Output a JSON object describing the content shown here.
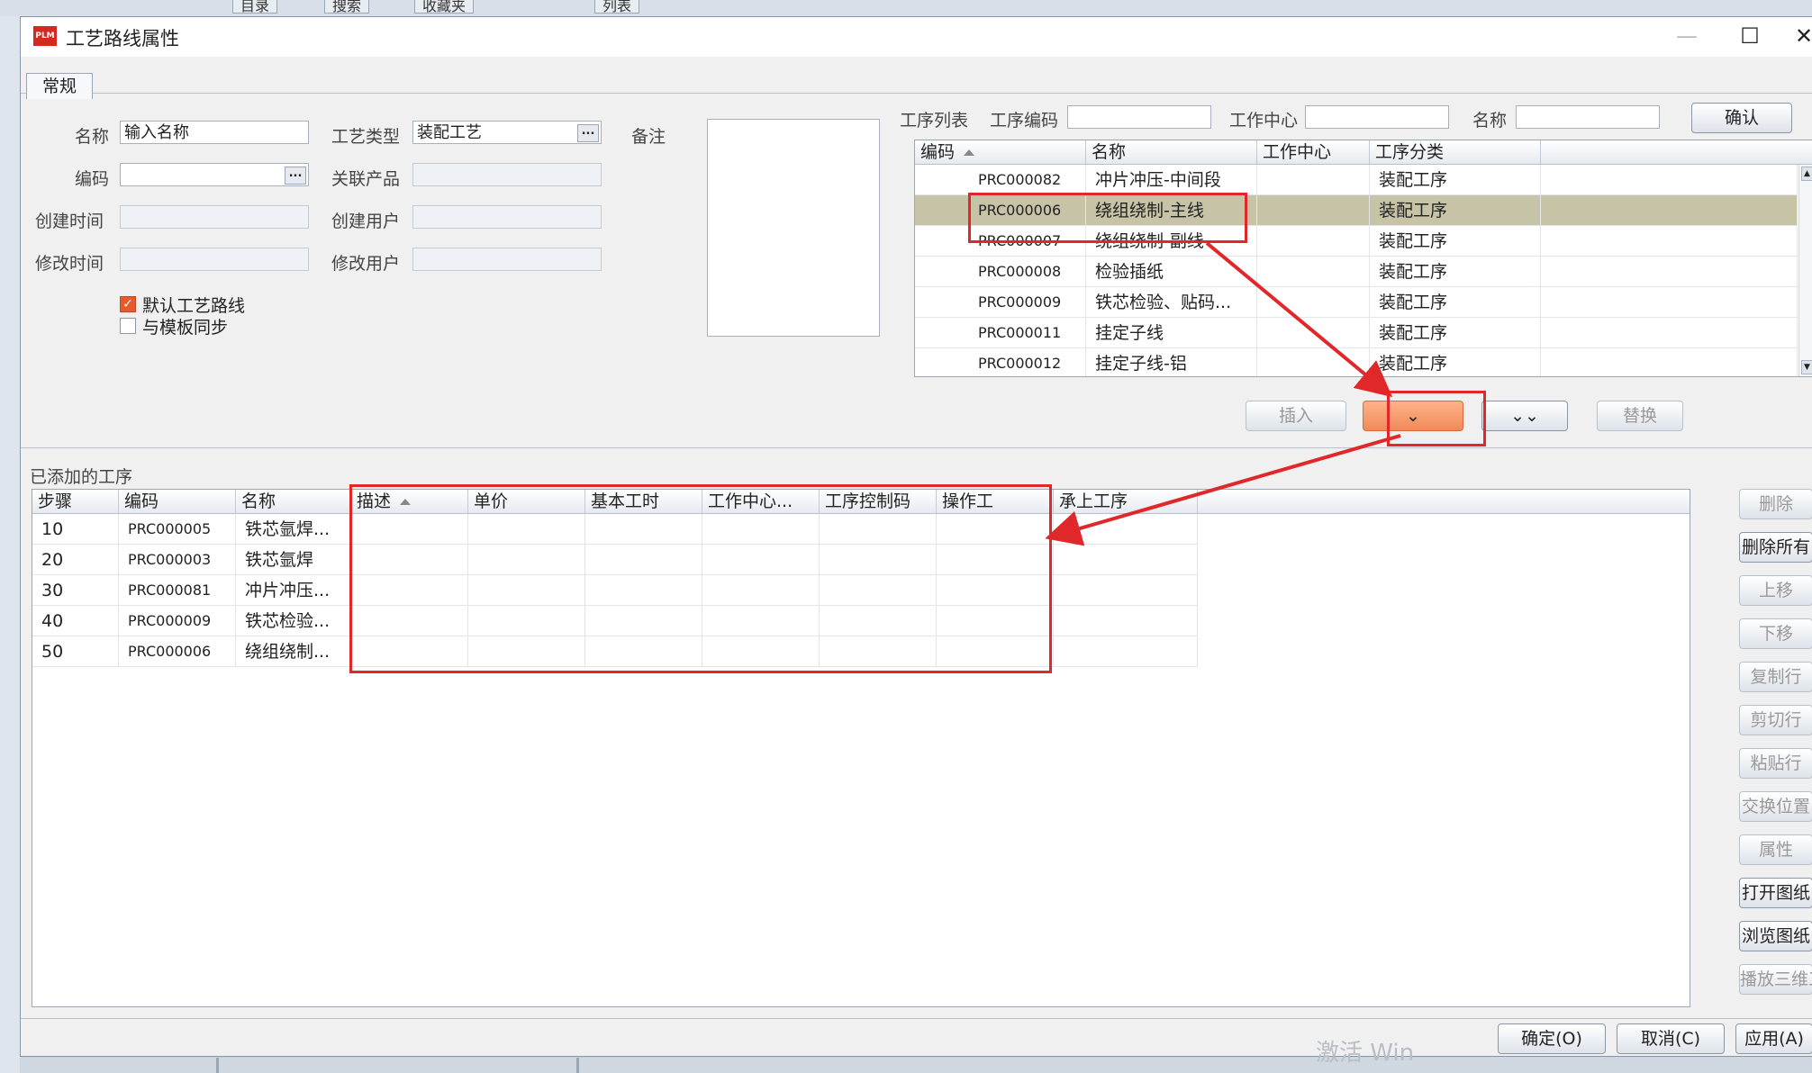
{
  "background": {
    "tabs": [
      "目录",
      "搜索",
      "收藏夹",
      "列表"
    ]
  },
  "window": {
    "title": "工艺路线属性",
    "app_icon": "PLM",
    "controls": {
      "minimize": "—",
      "maximize": "☐",
      "close": "✕"
    }
  },
  "tabs": {
    "general": "常规"
  },
  "form": {
    "name_label": "名称",
    "name_value": "输入名称",
    "code_label": "编码",
    "code_value": "",
    "created_time_label": "创建时间",
    "created_time_value": "",
    "modified_time_label": "修改时间",
    "modified_time_value": "",
    "process_type_label": "工艺类型",
    "process_type_value": "装配工艺",
    "related_product_label": "关联产品",
    "related_product_value": "",
    "created_user_label": "创建用户",
    "created_user_value": "",
    "modified_user_label": "修改用户",
    "modified_user_value": "",
    "remark_label": "备注",
    "default_route_label": "默认工艺路线",
    "default_route_checked": true,
    "template_sync_label": "与模板同步",
    "template_sync_checked": false,
    "ellipsis": "..."
  },
  "filter": {
    "op_list_label": "工序列表",
    "op_code_label": "工序编码",
    "work_center_label": "工作中心",
    "name_label": "名称",
    "confirm_button": "确认"
  },
  "op_grid": {
    "columns": [
      "编码",
      "名称",
      "工作中心",
      "工序分类"
    ],
    "rows": [
      [
        "PRC000082",
        "冲片冲压-中间段",
        "",
        "装配工序"
      ],
      [
        "PRC000006",
        "绕组绕制-主线",
        "",
        "装配工序"
      ],
      [
        "PRC000007",
        "绕组绕制-副线",
        "",
        "装配工序"
      ],
      [
        "PRC000008",
        "检验插纸",
        "",
        "装配工序"
      ],
      [
        "PRC000009",
        "铁芯检验、贴码...",
        "",
        "装配工序"
      ],
      [
        "PRC000011",
        "挂定子线",
        "",
        "装配工序"
      ],
      [
        "PRC000012",
        "挂定子线-铝",
        "",
        "装配工序"
      ]
    ],
    "selected_row": 1
  },
  "middle_buttons": {
    "insert": "插入",
    "add_down": "⌄",
    "add_all_down": "⌄⌄",
    "replace": "替换"
  },
  "added": {
    "section_label": "已添加的工序",
    "columns": [
      "步骤",
      "编码",
      "名称",
      "描述",
      "单价",
      "基本工时",
      "工作中心...",
      "工序控制码",
      "操作工",
      "承上工序"
    ],
    "rows": [
      [
        "10",
        "PRC000005",
        "铁芯氩焊...",
        "",
        "",
        "",
        "",
        "",
        "",
        ""
      ],
      [
        "20",
        "PRC000003",
        "铁芯氩焊",
        "",
        "",
        "",
        "",
        "",
        "",
        ""
      ],
      [
        "30",
        "PRC000081",
        "冲片冲压...",
        "",
        "",
        "",
        "",
        "",
        "",
        ""
      ],
      [
        "40",
        "PRC000009",
        "铁芯检验...",
        "",
        "",
        "",
        "",
        "",
        "",
        ""
      ],
      [
        "50",
        "PRC000006",
        "绕组绕制...",
        "",
        "",
        "",
        "",
        "",
        "",
        ""
      ]
    ]
  },
  "side_buttons": [
    {
      "label": "删除",
      "enabled": false
    },
    {
      "label": "删除所有",
      "enabled": true
    },
    {
      "label": "上移",
      "enabled": false
    },
    {
      "label": "下移",
      "enabled": false
    },
    {
      "label": "复制行",
      "enabled": false
    },
    {
      "label": "剪切行",
      "enabled": false
    },
    {
      "label": "粘贴行",
      "enabled": false
    },
    {
      "label": "交换位置",
      "enabled": false
    },
    {
      "label": "属性",
      "enabled": false
    },
    {
      "label": "打开图纸",
      "enabled": true
    },
    {
      "label": "浏览图纸",
      "enabled": true
    },
    {
      "label": "播放三维工艺",
      "enabled": false
    }
  ],
  "footer": {
    "ok": "确定(O)",
    "cancel": "取消(C)",
    "apply": "应用(A)"
  },
  "watermark": "激活 Win",
  "colors": {
    "selected_row": "#c7c3a7",
    "annotation_red": "#e0282a",
    "accent_orange": "#f08a58"
  }
}
